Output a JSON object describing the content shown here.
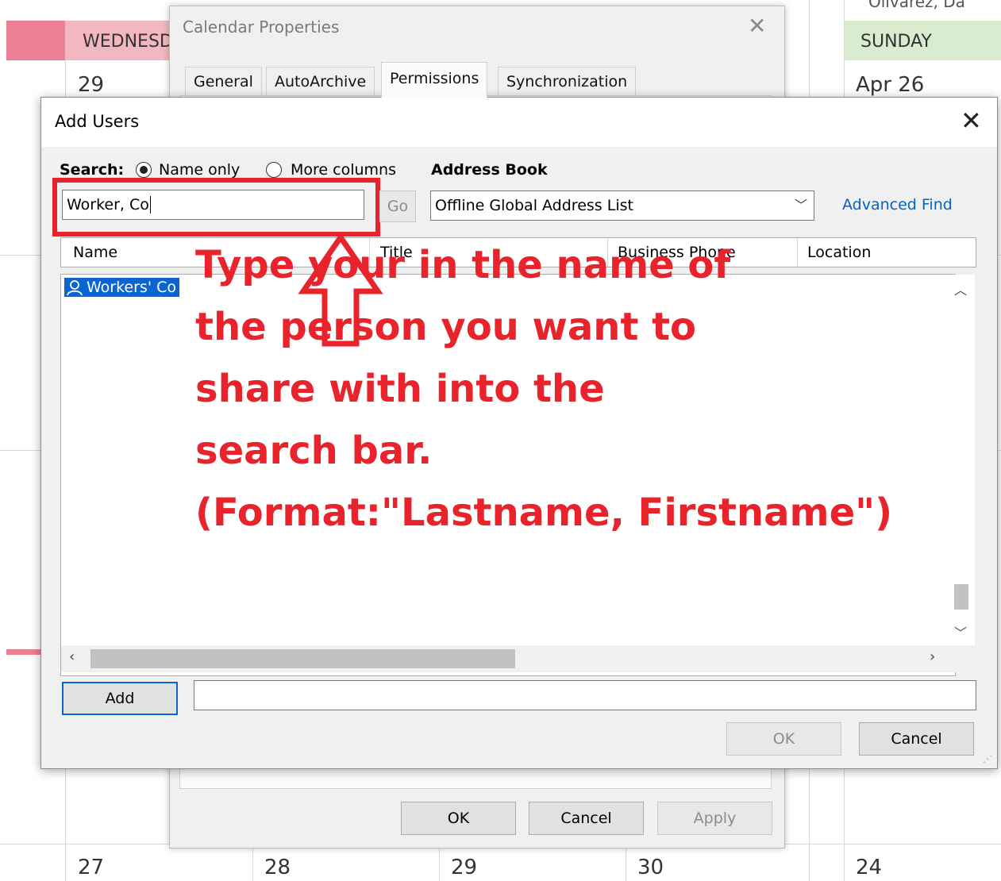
{
  "calendar": {
    "headers": {
      "wednesday": "WEDNESD",
      "sunday": "SUNDAY"
    },
    "top_dates": {
      "wed": "29",
      "sun": "Apr 26"
    },
    "top_right_partial": "Olivarez, Da",
    "bottom_dates": [
      "27",
      "28",
      "29",
      "30",
      "24"
    ]
  },
  "calendar_properties": {
    "title": "Calendar Properties",
    "tabs": [
      "General",
      "AutoArchive",
      "Permissions",
      "Synchronization"
    ],
    "active_tab": "Permissions",
    "buttons": {
      "ok": "OK",
      "cancel": "Cancel",
      "apply": "Apply"
    }
  },
  "add_users": {
    "title": "Add Users",
    "search_label": "Search:",
    "radio_name_only": "Name only",
    "radio_more_columns": "More columns",
    "selected_radio": "Name only",
    "address_book_label": "Address Book",
    "search_value": "Worker, Co",
    "go_button": "Go",
    "address_book_value": "Offline Global Address List",
    "advanced_find": "Advanced Find",
    "columns": [
      "Name",
      "Title",
      "Business Phone",
      "Location"
    ],
    "results": [
      {
        "name": "Workers' Co",
        "icon": "user-icon"
      }
    ],
    "add_button": "Add",
    "add_field_value": "",
    "ok_button": "OK",
    "cancel_button": "Cancel"
  },
  "annotation": {
    "lines": [
      "Type your in the name of",
      "the person you want to",
      "share with into the",
      "search bar.",
      "(Format:\"Lastname, Firstname\")"
    ],
    "color": "#e8232b"
  },
  "colors": {
    "accent_selection": "#0a64d2",
    "link": "#0563c1",
    "annotation_red": "#e8232b"
  }
}
